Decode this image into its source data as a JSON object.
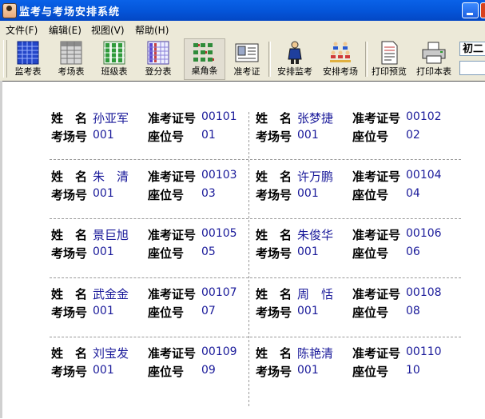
{
  "window": {
    "title": "监考与考场安排系统"
  },
  "menu": [
    "文件(F)",
    "编辑(E)",
    "视图(V)",
    "帮助(H)"
  ],
  "toolbar": {
    "buttons": [
      {
        "label": "监考表",
        "icon": "grid-table-blue-icon"
      },
      {
        "label": "考场表",
        "icon": "grid-table-gray-icon"
      },
      {
        "label": "班级表",
        "icon": "grid-table-green-icon"
      },
      {
        "label": "登分表",
        "icon": "grid-table-purple-icon"
      },
      {
        "label": "桌角条",
        "icon": "desk-labels-icon",
        "pressed": true
      },
      {
        "label": "准考证",
        "icon": "admission-ticket-icon"
      },
      {
        "label": "安排监考",
        "icon": "person-icon"
      },
      {
        "label": "安排考场",
        "icon": "people-group-icon"
      },
      {
        "label": "打印预览",
        "icon": "print-preview-icon"
      },
      {
        "label": "打印本表",
        "icon": "printer-icon"
      }
    ],
    "grade_select": "初二"
  },
  "labels": {
    "name": "姓　名",
    "ticket": "准考证号",
    "room": "考场号",
    "seat": "座位号"
  },
  "cards": [
    {
      "name": "孙亚军",
      "ticket": "00101",
      "room": "001",
      "seat": "01"
    },
    {
      "name": "张梦捷",
      "ticket": "00102",
      "room": "001",
      "seat": "02"
    },
    {
      "name": "朱　清",
      "ticket": "00103",
      "room": "001",
      "seat": "03"
    },
    {
      "name": "许万鹏",
      "ticket": "00104",
      "room": "001",
      "seat": "04"
    },
    {
      "name": "景巨旭",
      "ticket": "00105",
      "room": "001",
      "seat": "05"
    },
    {
      "name": "朱俊华",
      "ticket": "00106",
      "room": "001",
      "seat": "06"
    },
    {
      "name": "武金金",
      "ticket": "00107",
      "room": "001",
      "seat": "07"
    },
    {
      "name": "周　恬",
      "ticket": "00108",
      "room": "001",
      "seat": "08"
    },
    {
      "name": "刘宝发",
      "ticket": "00109",
      "room": "001",
      "seat": "09"
    },
    {
      "name": "陈艳清",
      "ticket": "00110",
      "room": "001",
      "seat": "10"
    }
  ],
  "colors": {
    "titlebar": "#0454d8",
    "value_text": "#1a1a9a",
    "chrome": "#ece9d8"
  }
}
